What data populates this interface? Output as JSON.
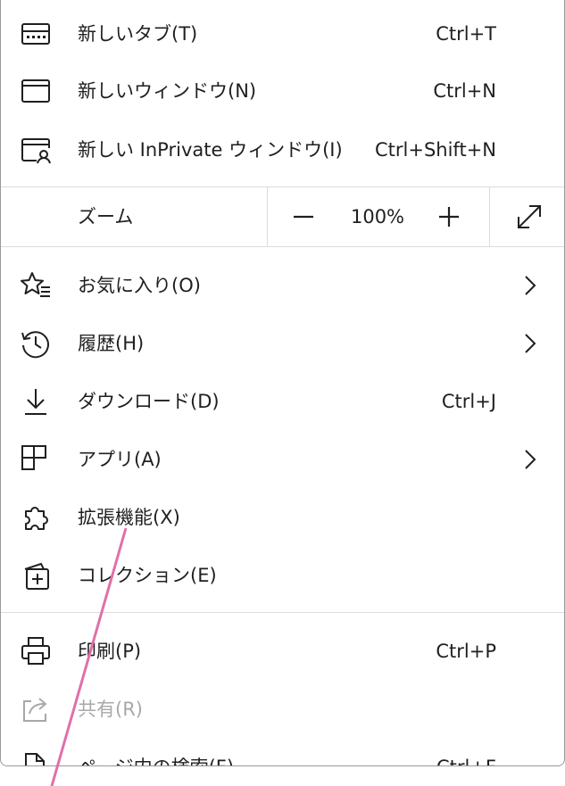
{
  "menu": {
    "new_tab": {
      "label": "新しいタブ(T)",
      "shortcut": "Ctrl+T",
      "icon": "new-tab-icon"
    },
    "new_window": {
      "label": "新しいウィンドウ(N)",
      "shortcut": "Ctrl+N",
      "icon": "new-window-icon"
    },
    "new_private": {
      "label": "新しい InPrivate ウィンドウ(I)",
      "shortcut": "Ctrl+Shift+N",
      "icon": "inprivate-icon"
    },
    "zoom": {
      "label": "ズーム",
      "value": "100%",
      "minus_icon": "minus-icon",
      "plus_icon": "plus-icon",
      "fullscreen_icon": "fullscreen-icon"
    },
    "favorites": {
      "label": "お気に入り(O)",
      "icon": "favorites-icon"
    },
    "history": {
      "label": "履歴(H)",
      "icon": "history-icon"
    },
    "downloads": {
      "label": "ダウンロード(D)",
      "shortcut": "Ctrl+J",
      "icon": "download-icon"
    },
    "apps": {
      "label": "アプリ(A)",
      "icon": "apps-icon"
    },
    "extensions": {
      "label": "拡張機能(X)",
      "icon": "extensions-icon"
    },
    "collections": {
      "label": "コレクション(E)",
      "icon": "collections-icon"
    },
    "print": {
      "label": "印刷(P)",
      "shortcut": "Ctrl+P",
      "icon": "print-icon"
    },
    "share": {
      "label": "共有(R)",
      "icon": "share-icon"
    },
    "find": {
      "label": "ページ内の検索(F)",
      "shortcut": "Ctrl+F",
      "icon": "find-icon"
    }
  },
  "colors": {
    "text": "#1f1f1f",
    "disabled": "#a8a8a8",
    "separator": "#dcdcdc",
    "annotation": "#e070a8"
  }
}
